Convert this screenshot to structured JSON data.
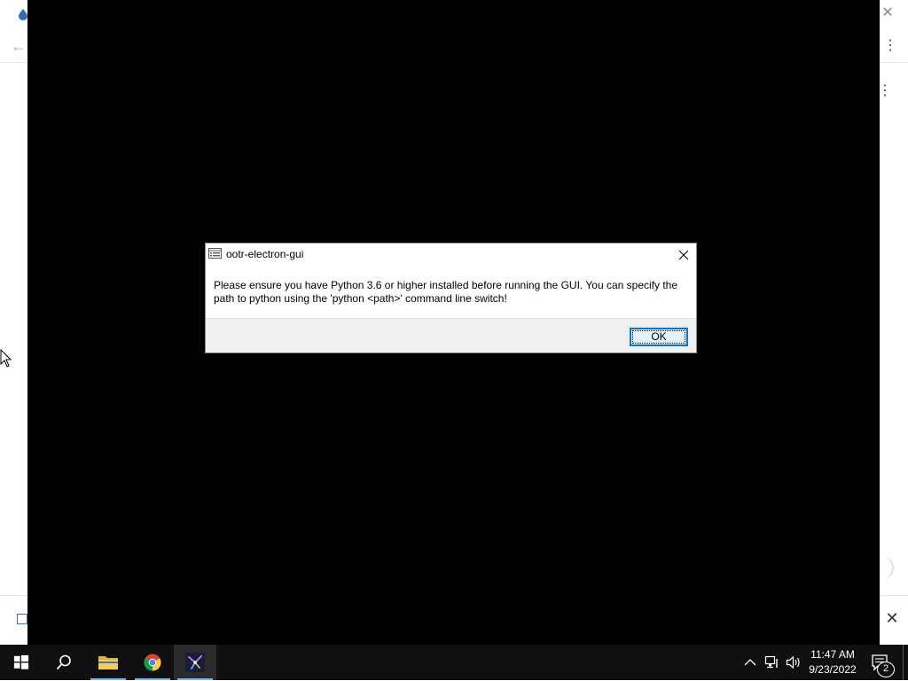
{
  "dialog": {
    "title": "ootr-electron-gui",
    "message": "Please ensure you have Python 3.6 or higher installed before running the GUI. You can specify the path to python using the 'python <path>' command line switch!",
    "ok_label": "OK"
  },
  "taskbar": {
    "items": [
      "start-icon",
      "search-icon",
      "file-explorer-icon",
      "chrome-icon",
      "ootr-app-icon"
    ],
    "clock_time": "11:47 AM",
    "clock_date": "9/23/2022",
    "notification_count": "2"
  },
  "colors": {
    "app_background": "#000000",
    "taskbar": "#101010",
    "accent": "#0078d7",
    "dialog_footer": "#f0f0f0"
  }
}
